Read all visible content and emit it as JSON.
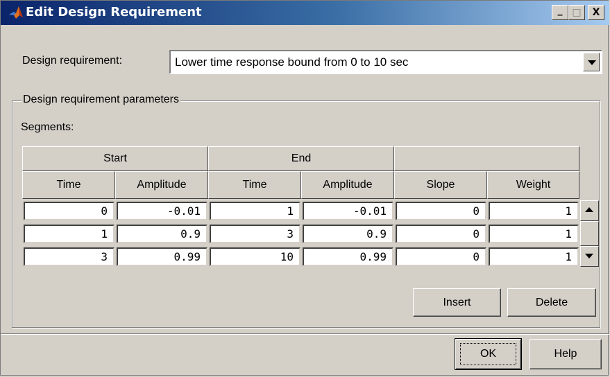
{
  "window": {
    "title": "Edit Design Requirement",
    "minimize": "_",
    "maximize": "□",
    "close": "X"
  },
  "requirement": {
    "label": "Design requirement:",
    "selected": "Lower time response bound from 0 to 10 sec"
  },
  "parameters": {
    "group_label": "Design requirement parameters",
    "segments_label": "Segments:",
    "group_headers": [
      "Start",
      "End",
      ""
    ],
    "columns": [
      "Time",
      "Amplitude",
      "Time",
      "Amplitude",
      "Slope",
      "Weight"
    ],
    "rows": [
      [
        "0",
        "-0.01",
        "1",
        "-0.01",
        "0",
        "1"
      ],
      [
        "1",
        "0.9",
        "3",
        "0.9",
        "0",
        "1"
      ],
      [
        "3",
        "0.99",
        "10",
        "0.99",
        "0",
        "1"
      ]
    ]
  },
  "buttons": {
    "insert": "Insert",
    "delete": "Delete",
    "ok": "OK",
    "help": "Help"
  },
  "colors": {
    "title_start": "#0a246a",
    "title_end": "#a6caf0",
    "face": "#d4d0c8"
  },
  "icons": {
    "app": "matlab-logo-icon",
    "dropdown": "chevron-down-icon"
  }
}
